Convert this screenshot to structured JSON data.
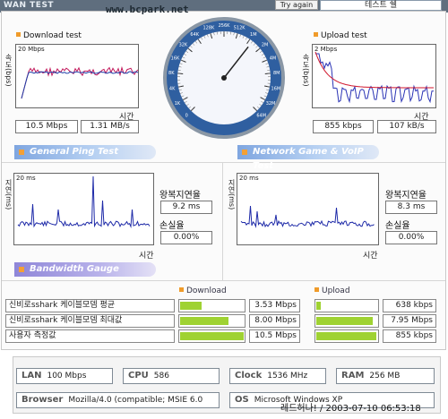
{
  "header": {
    "title": "WAN TEST",
    "watermark": "www.bcpark.net",
    "try_again_label": "Try again",
    "test_title": "테스트 쉘"
  },
  "download": {
    "label": "Download test",
    "scale": "20 Mbps",
    "axis_label": "속도(bps)",
    "time_label": "시간",
    "value_bps": "10.5 Mbps",
    "value_Bps": "1.31 MB/s"
  },
  "upload": {
    "label": "Upload test",
    "scale": "2 Mbps",
    "axis_label": "속도(bps)",
    "time_label": "시간",
    "value_bps": "855 kbps",
    "value_Bps": "107 kB/s"
  },
  "gauge": {
    "ticks": [
      "0",
      "1K",
      "4K",
      "8K",
      "16K",
      "32K",
      "64K",
      "128K",
      "256K",
      "512K",
      "1M",
      "2M",
      "4M",
      "8M",
      "16M",
      "32M",
      "64M"
    ],
    "needle_label": "10.5 Mbps"
  },
  "ping": {
    "band_label": "General Ping Test",
    "axis_label": "지연(ms)",
    "scale": "20 ms",
    "time_label": "시간",
    "rtt_label": "왕복지연율",
    "rtt_value": "9.2 ms",
    "loss_label": "손실율",
    "loss_value": "0.00%"
  },
  "game": {
    "band_label": "Network Game & VoIP Test",
    "axis_label": "지연(ms)",
    "scale": "20 ms",
    "time_label": "시간",
    "rtt_label": "왕복지연율",
    "rtt_value": "8.3 ms",
    "loss_label": "손실율",
    "loss_value": "0.00%"
  },
  "bandwidth": {
    "band_label": "Bandwidth Gauge",
    "download_label": "Download",
    "upload_label": "Upload",
    "rows": [
      {
        "label": "신비로sshark 케이블모뎀 평균",
        "down": "3.53 Mbps",
        "down_fraction": 0.34,
        "up": "638 kbps",
        "up_fraction": 0.07
      },
      {
        "label": "신비로sshark 케이블모뎀 최대값",
        "down": "8.00 Mbps",
        "down_fraction": 0.76,
        "up": "7.95 Mbps",
        "up_fraction": 0.92
      },
      {
        "label": "사용자 측정값",
        "down": "10.5 Mbps",
        "down_fraction": 1.0,
        "up": "855 kbps",
        "up_fraction": 0.98
      }
    ]
  },
  "system": {
    "lan_label": "LAN",
    "lan_value": "100 Mbps",
    "cpu_label": "CPU",
    "cpu_value": "586",
    "clock_label": "Clock",
    "clock_value": "1536 MHz",
    "ram_label": "RAM",
    "ram_value": "256 MB",
    "browser_label": "Browser",
    "browser_value": "Mozilla/4.0 (compatible; MSIE 6.0",
    "os_label": "OS",
    "os_value": "Microsoft Windows XP"
  },
  "datestamp": "레드허나! / 2003-07-10 06:53:18",
  "colors": {
    "download_line": "#c2185b",
    "download_avg": "#1d3ea8",
    "upload_line": "#2a33b5",
    "upload_avg": "#d0162c",
    "ping_line": "#1e2aa8",
    "bar_fill": "#9fd232",
    "accent_square": "#f09b2a"
  }
}
